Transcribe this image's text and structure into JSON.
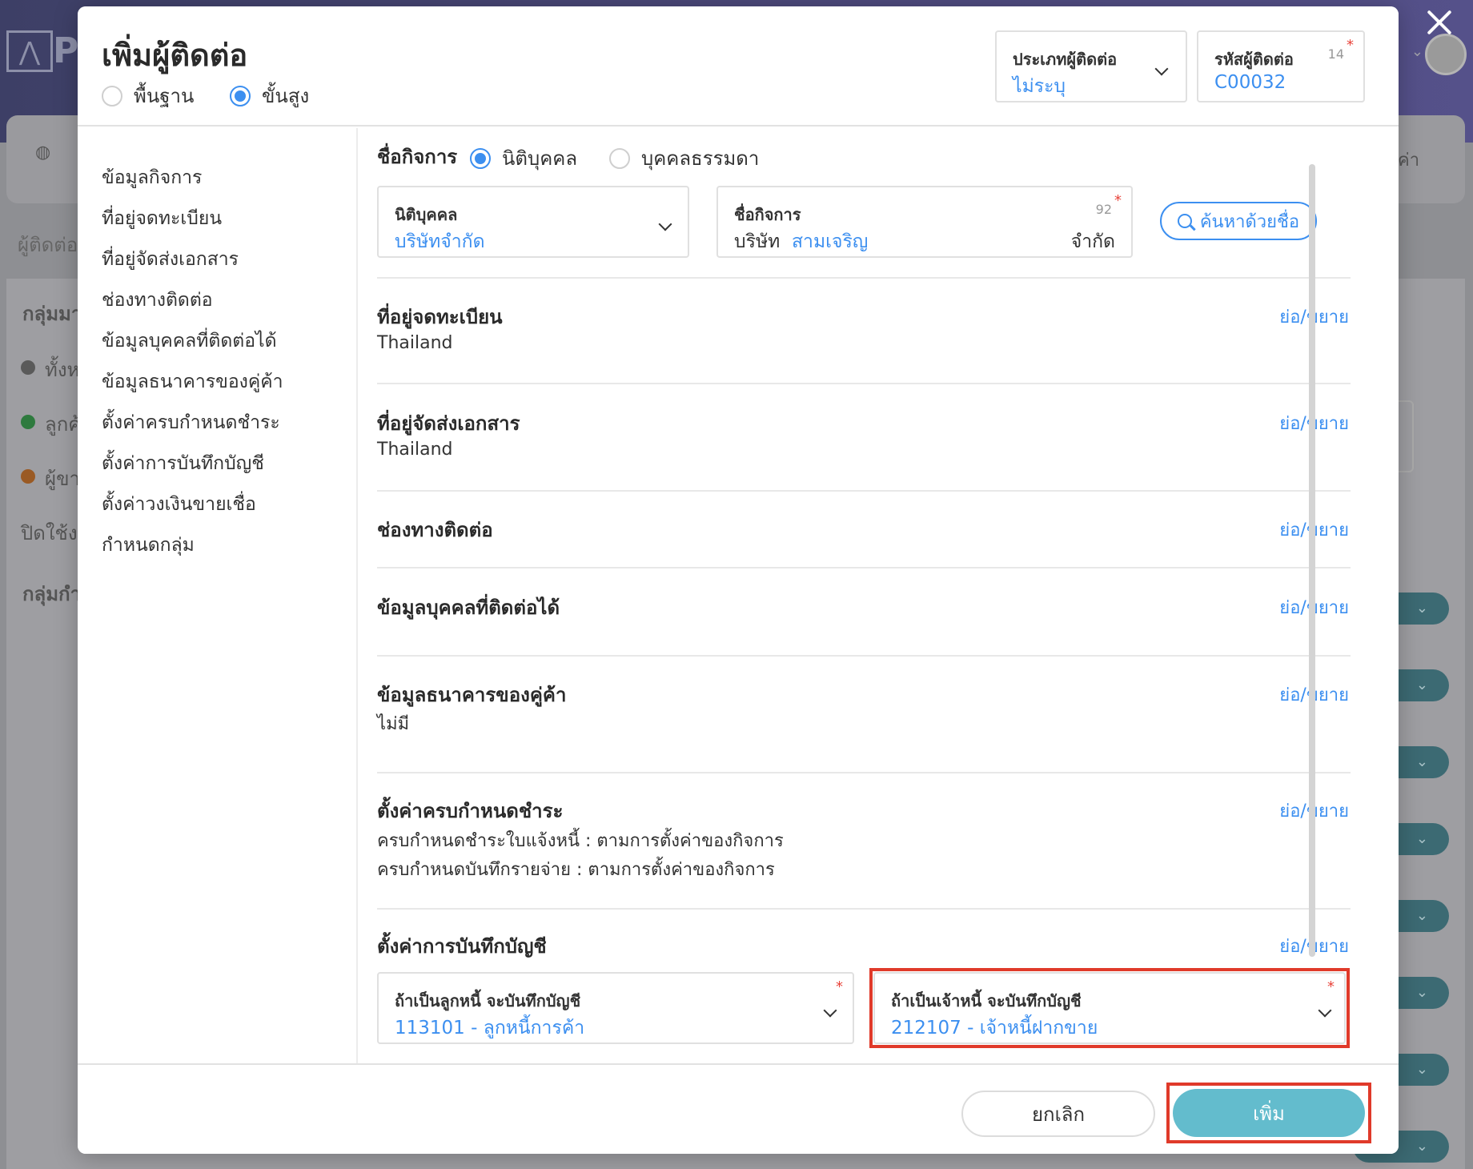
{
  "modal": {
    "title": "เพิ่มผู้ติดต่อ",
    "modes": [
      "พื้นฐาน",
      "ขั้นสูง"
    ],
    "selected_mode": "ขั้นสูง",
    "contact_type": {
      "label": "ประเภทผู้ติดต่อ",
      "value": "ไม่ระบุ"
    },
    "contact_code": {
      "label": "รหัสผู้ติดต่อ",
      "value": "C00032",
      "char_count": "14",
      "required_mark": "*"
    }
  },
  "nav": {
    "items": [
      "ข้อมูลกิจการ",
      "ที่อยู่จดทะเบียน",
      "ที่อยู่จัดส่งเอกสาร",
      "ช่องทางติดต่อ",
      "ข้อมูลบุคคลที่ติดต่อได้",
      "ข้อมูลธนาคารของคู่ค้า",
      "ตั้งค่าครบกำหนดชำระ",
      "ตั้งค่าการบันทึกบัญชี",
      "ตั้งค่าวงเงินขายเชื่อ",
      "กำหนดกลุ่ม"
    ]
  },
  "business": {
    "label": "ชื่อกิจการ",
    "types": [
      "นิติบุคคล",
      "บุคคลธรรมดา"
    ],
    "selected_type": "นิติบุคคล",
    "entity": {
      "label": "นิติบุคคล",
      "value": "บริษัทจำกัด"
    },
    "name": {
      "label": "ชื่อกิจการ",
      "prefix": "บริษัท",
      "value": "สามเจริญ",
      "suffix": "จำกัด",
      "char_count": "92",
      "required_mark": "*"
    },
    "search_button": "ค้นหาด้วยชื่อ"
  },
  "sections": {
    "toggle_label": "ย่อ/ขยาย",
    "registered_address": {
      "title": "ที่อยู่จดทะเบียน",
      "text": "Thailand"
    },
    "shipping_address": {
      "title": "ที่อยู่จัดส่งเอกสาร",
      "text": "Thailand"
    },
    "contact_channels": {
      "title": "ช่องทางติดต่อ"
    },
    "contact_persons": {
      "title": "ข้อมูลบุคคลที่ติดต่อได้"
    },
    "bank_info": {
      "title": "ข้อมูลธนาคารของคู่ค้า",
      "text": "ไม่มี"
    },
    "payment_terms": {
      "title": "ตั้งค่าครบกำหนดชำระ",
      "lines": [
        "ครบกำหนดชำระใบแจ้งหนี้ : ตามการตั้งค่าของกิจการ",
        "ครบกำหนดบันทึกรายจ่าย : ตามการตั้งค่าของกิจการ"
      ]
    },
    "accounting": {
      "title": "ตั้งค่าการบันทึกบัญชี",
      "debtor": {
        "label": "ถ้าเป็นลูกหนี้ จะบันทึกบัญชี",
        "value": "113101 - ลูกหนี้การค้า",
        "required_mark": "*"
      },
      "creditor": {
        "label": "ถ้าเป็นเจ้าหนี้ จะบันทึกบัญชี",
        "value": "212107 - เจ้าหนี้ฝากขาย",
        "required_mark": "*"
      }
    }
  },
  "footer": {
    "cancel": "ยกเลิก",
    "add": "เพิ่ม"
  },
  "background": {
    "logo_text": "P",
    "labels": [
      "ผู้ติดต่อ",
      "กลุ่มมา",
      "ทั้งห",
      "ลูกค้",
      "ผู้ขา",
      "ปิดใช้งา",
      "กลุ่มกำ",
      "ค่า"
    ]
  },
  "colors": {
    "accent": "#3c8ff0",
    "primary_button": "#63bccd",
    "highlight": "#e03a2a",
    "required": "#e8433a"
  }
}
